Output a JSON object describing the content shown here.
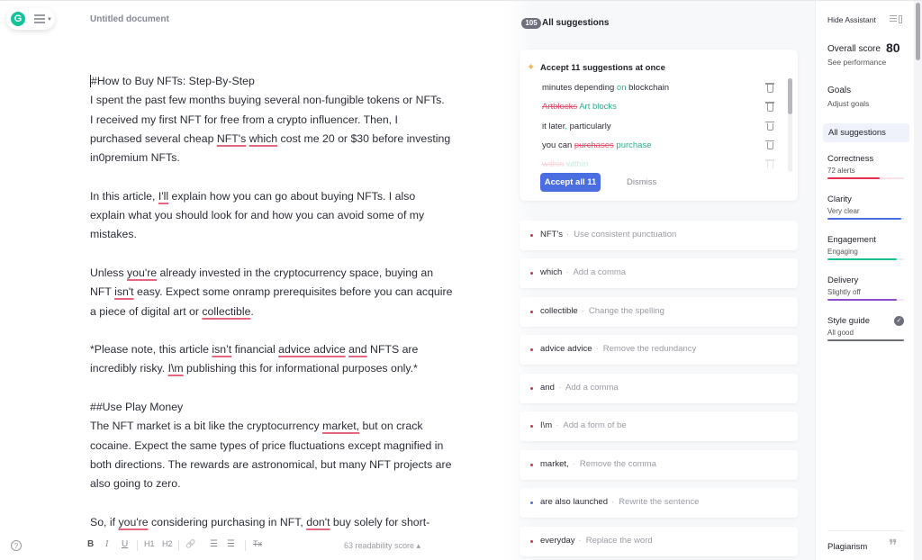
{
  "editor": {
    "doc_title": "Untitled document",
    "paragraphs": {
      "p1_l1": "#How to Buy NFTs: Step-By-Step",
      "p1_l2": "I spent the past few months buying several non-fungible tokens or NFTs.",
      "p1_l3": "I received my first NFT for free from a crypto influencer. Then, I",
      "p1_l4a": "purchased several cheap ",
      "p1_l4_u1": "NFT's",
      "p1_l4_sp": " ",
      "p1_l4_u2": "which",
      "p1_l4b": " cost me 20 or $30 before investing",
      "p1_l5": "in0premium NFTs.",
      "p2_l1a": "In this article, ",
      "p2_l1_u": "I'll",
      "p2_l1b": " explain how you can go about buying NFTs. I also",
      "p2_l2": "explain what you should look for and how you can avoid some of my",
      "p2_l3": "mistakes.",
      "p3_l1a": "Unless ",
      "p3_l1_u": "you're",
      "p3_l1b": " already invested in the cryptocurrency space, buying an",
      "p3_l2a": "NFT ",
      "p3_l2_u": "isn't",
      "p3_l2b": " easy. Expect some onramp prerequisites before you can acquire",
      "p3_l3a": "a piece of digital art or ",
      "p3_l3_u": "collectible",
      "p3_l3b": ".",
      "p4_l1a": "*Please note, this article ",
      "p4_l1_u1": "isn’t",
      "p4_l1b": " financial ",
      "p4_l1_u2": "advice advice",
      "p4_l1c": " ",
      "p4_l1_u3": "and",
      "p4_l1d": " NFTS are",
      "p4_l2a": "incredibly risky. ",
      "p4_l2_u": "I\\m",
      "p4_l2b": " publishing this for informational purposes only.*",
      "p5_l1": "##Use Play Money",
      "p5_l2a": "The NFT market is a bit like the cryptocurrency ",
      "p5_l2_u": "market,",
      "p5_l2b": " but on crack",
      "p5_l3": "cocaine. Expect the same types of price fluctuations except magnified in",
      "p5_l4": "both directions. The rewards are astronomical, but many NFT projects are",
      "p5_l5": "also going to zero.",
      "p6_l1a": "So, if ",
      "p6_l1_u1": "you're",
      "p6_l1b": " considering purchasing in NFT, ",
      "p6_l1_u2": "don't",
      "p6_l1c": " buy solely for short-"
    },
    "toolbar": {
      "bold": "B",
      "italic": "I",
      "underline": "U",
      "h1": "H1",
      "h2": "H2",
      "link": "🔗",
      "ordered_list": "☰",
      "bullet_list": "☰",
      "clear_format": "Tx"
    },
    "readability": "63 readability score"
  },
  "suggestions": {
    "count": "105",
    "header": "All suggestions",
    "accept_card": {
      "title": "Accept 11 suggestions at once",
      "rows": [
        {
          "a": "minutes depending ",
          "ins": "on",
          "b": " blockchain"
        },
        {
          "del": "Artblocks",
          "ins": " Art blocks"
        },
        {
          "a": "it later",
          "ins": ",",
          "b": " particularly"
        },
        {
          "a": "you can ",
          "del": "purchases",
          "ins": " purchase"
        },
        {
          "del": "within",
          "ins": " within"
        }
      ],
      "accept_label": "Accept all 11",
      "dismiss_label": "Dismiss"
    },
    "items": [
      {
        "word": "NFT's",
        "desc": "Use consistent punctuation",
        "color": "red"
      },
      {
        "word": "which",
        "desc": "Add a comma",
        "color": "red"
      },
      {
        "word": "collectible",
        "desc": "Change the spelling",
        "color": "red"
      },
      {
        "word": "advice advice",
        "desc": "Remove the redundancy",
        "color": "red"
      },
      {
        "word": "and",
        "desc": "Add a comma",
        "color": "red"
      },
      {
        "word": "I\\m",
        "desc": "Add a form of be",
        "color": "red"
      },
      {
        "word": "market,",
        "desc": "Remove the comma",
        "color": "red"
      },
      {
        "word": "are also launched",
        "desc": "Rewrite the sentence",
        "color": "blue"
      },
      {
        "word": "everyday",
        "desc": "Replace the word",
        "color": "red"
      }
    ]
  },
  "assistant": {
    "hide_label": "Hide Assistant",
    "overall_label": "Overall score",
    "overall_score": "80",
    "see_performance": "See performance",
    "goals": "Goals",
    "adjust_goals": "Adjust goals",
    "all_suggestions": "All suggestions",
    "categories": [
      {
        "name": "Correctness",
        "sub": "72 alerts",
        "color": "#e5304f",
        "track": "#fbe3e7",
        "progress": 0.68
      },
      {
        "name": "Clarity",
        "sub": "Very clear",
        "color": "#4a6ee0",
        "track": "#e4e9fa",
        "progress": 0.96
      },
      {
        "name": "Engagement",
        "sub": "Engaging",
        "color": "#15c39a",
        "track": "#dff6ef",
        "progress": 0.9
      },
      {
        "name": "Delivery",
        "sub": "Slightly off",
        "color": "#8b4fc8",
        "track": "#efe5f8",
        "progress": 0.9
      },
      {
        "name": "Style guide",
        "sub": "All good",
        "color": "#6d6f7b",
        "track": "#e4e4e8",
        "progress": 1.0
      }
    ],
    "plagiarism": "Plagiarism",
    "accent": "#15c39a"
  }
}
